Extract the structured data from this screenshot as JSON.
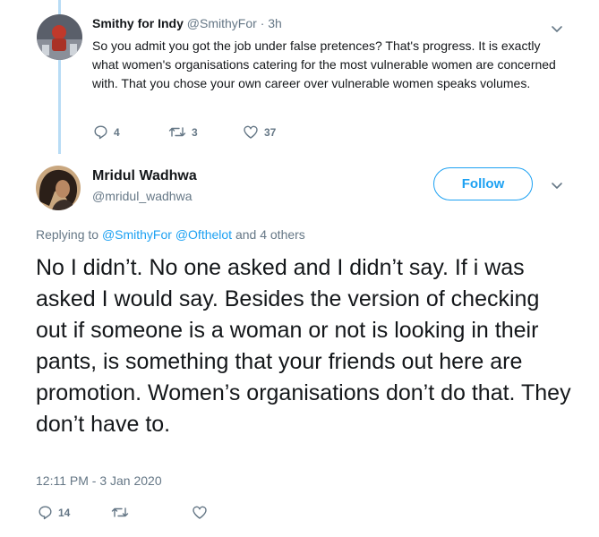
{
  "parent_tweet": {
    "display_name": "Smithy for Indy",
    "handle": "@SmithyFor",
    "separator": "·",
    "time": "3h",
    "text": "So you admit you got the job under false pretences? That's progress. It is exactly what women's organisations catering for the most vulnerable women are concerned with. That you chose your own career over vulnerable women speaks volumes.",
    "reply_count": "4",
    "retweet_count": "3",
    "like_count": "37",
    "avatar_icon": "avatar-photo"
  },
  "main_tweet": {
    "display_name": "Mridul Wadhwa",
    "handle": "@mridul_wadhwa",
    "follow_label": "Follow",
    "replying_prefix": "Replying to",
    "replying_users": [
      "@SmithyFor",
      "@Ofthelot"
    ],
    "replying_suffix": "and 4 others",
    "text": "No I didn’t. No one asked and I didn’t say. If i was asked I would say. Besides the  version of checking out if someone is a woman or not is looking in their pants, is something that your friends out here are promotion. Women’s organisations don’t do that. They don’t have to.",
    "timestamp": "12:11 PM - 3 Jan 2020",
    "reply_count": "14",
    "avatar_icon": "avatar-photo"
  },
  "colors": {
    "accent": "#1da1f2",
    "muted": "#657786",
    "text": "#14171a",
    "thread_line": "#b8dcf5"
  },
  "icons": [
    "reply-icon",
    "retweet-icon",
    "like-icon",
    "chevron-down-icon"
  ]
}
